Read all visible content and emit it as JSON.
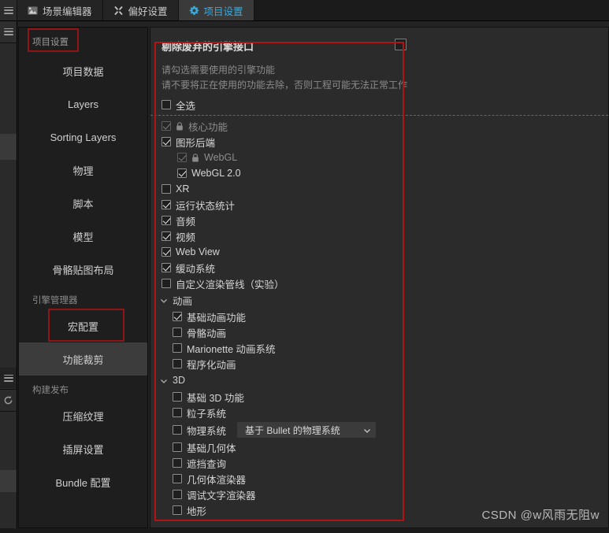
{
  "window": {
    "tabs": [
      {
        "label": "场景编辑器",
        "icon": "scene-icon",
        "active": false
      },
      {
        "label": "偏好设置",
        "icon": "wrench-icon",
        "active": false
      },
      {
        "label": "项目设置",
        "icon": "gear-icon",
        "active": true
      }
    ],
    "menu_icon": "hamburger-icon"
  },
  "rail": {
    "items": [
      {
        "icon": "hamburger-icon"
      },
      {
        "icon": "hamburger-icon"
      },
      {
        "icon": "refresh-icon"
      }
    ]
  },
  "sidebar": {
    "title": "项目设置",
    "items": [
      {
        "label": "项目数据",
        "selected": false
      },
      {
        "label": "Layers",
        "selected": false
      },
      {
        "label": "Sorting Layers",
        "selected": false
      },
      {
        "label": "物理",
        "selected": false
      },
      {
        "label": "脚本",
        "selected": false
      },
      {
        "label": "模型",
        "selected": false
      },
      {
        "label": "骨骼贴图布局",
        "selected": false
      }
    ],
    "groups": [
      {
        "label": "引擎管理器",
        "items": [
          {
            "label": "宏配置",
            "selected": false
          },
          {
            "label": "功能裁剪",
            "selected": true
          }
        ]
      },
      {
        "label": "构建发布",
        "items": [
          {
            "label": "压缩纹理",
            "selected": false
          },
          {
            "label": "插屏设置",
            "selected": false
          },
          {
            "label": "Bundle 配置",
            "selected": false
          }
        ]
      }
    ]
  },
  "main": {
    "title": "剔除废弃的引擎接口",
    "title_checkbox": {
      "checked": false
    },
    "hint_line1": "请勾选需要使用的引擎功能",
    "hint_line2": "请不要将正在使用的功能去除，否则工程可能无法正常工作",
    "select_all": {
      "label": "全选",
      "checked": false
    },
    "features": [
      {
        "label": "核心功能",
        "checked": true,
        "locked": true,
        "disabled": true,
        "indent": 0
      },
      {
        "label": "图形后端",
        "checked": true,
        "locked": false,
        "disabled": false,
        "indent": 0
      },
      {
        "label": "WebGL",
        "checked": true,
        "locked": true,
        "disabled": true,
        "indent": 1
      },
      {
        "label": "WebGL 2.0",
        "checked": true,
        "locked": false,
        "disabled": false,
        "indent": 1
      },
      {
        "label": "XR",
        "checked": false,
        "locked": false,
        "disabled": false,
        "indent": 0
      },
      {
        "label": "运行状态统计",
        "checked": true,
        "locked": false,
        "disabled": false,
        "indent": 0
      },
      {
        "label": "音频",
        "checked": true,
        "locked": false,
        "disabled": false,
        "indent": 0
      },
      {
        "label": "视频",
        "checked": true,
        "locked": false,
        "disabled": false,
        "indent": 0
      },
      {
        "label": "Web View",
        "checked": true,
        "locked": false,
        "disabled": false,
        "indent": 0
      },
      {
        "label": "缓动系统",
        "checked": true,
        "locked": false,
        "disabled": false,
        "indent": 0
      },
      {
        "label": "自定义渲染管线（实验）",
        "checked": false,
        "locked": false,
        "disabled": false,
        "indent": 0
      }
    ],
    "sections": [
      {
        "label": "动画",
        "expanded": true,
        "items": [
          {
            "label": "基础动画功能",
            "checked": true
          },
          {
            "label": "骨骼动画",
            "checked": false
          },
          {
            "label": "Marionette 动画系统",
            "checked": false
          },
          {
            "label": "程序化动画",
            "checked": false
          }
        ]
      },
      {
        "label": "3D",
        "expanded": true,
        "items": [
          {
            "label": "基础 3D 功能",
            "checked": false
          },
          {
            "label": "粒子系统",
            "checked": false
          },
          {
            "label": "物理系统",
            "checked": false,
            "select_value": "基于 Bullet 的物理系统"
          },
          {
            "label": "基础几何体",
            "checked": false
          },
          {
            "label": "遮挡查询",
            "checked": false
          },
          {
            "label": "几何体渲染器",
            "checked": false
          },
          {
            "label": "调试文字渲染器",
            "checked": false
          },
          {
            "label": "地形",
            "checked": false
          }
        ]
      }
    ]
  },
  "watermark": "CSDN @w风雨无阻w",
  "colors": {
    "accent": "#3fa9d8",
    "annotation": "#8f1616",
    "panel_bg": "#2b2b2b",
    "sidebar_bg": "#1e1e1e"
  }
}
